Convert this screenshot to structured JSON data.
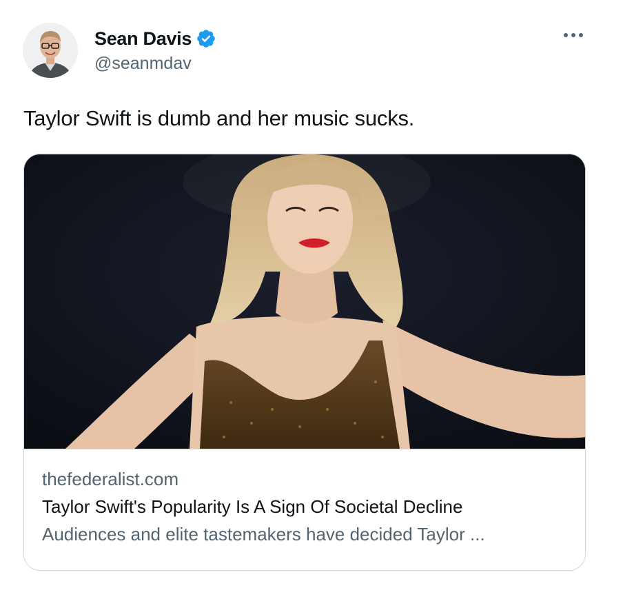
{
  "author": {
    "display_name": "Sean Davis",
    "handle": "@seanmdav",
    "verified": true,
    "avatar_icon": "user-avatar"
  },
  "tweet": {
    "text": "Taylor Swift is dumb and her music sucks."
  },
  "menu": {
    "more_icon": "more-horizontal-icon"
  },
  "card": {
    "domain": "thefederalist.com",
    "title": "Taylor Swift's Popularity Is A Sign Of Societal Decline",
    "description": "Audiences and elite tastemakers have decided Taylor ..."
  },
  "colors": {
    "verified_blue": "#1d9bf0",
    "secondary_text": "#536471",
    "primary_text": "#0f1419",
    "border": "#cfd9de"
  }
}
